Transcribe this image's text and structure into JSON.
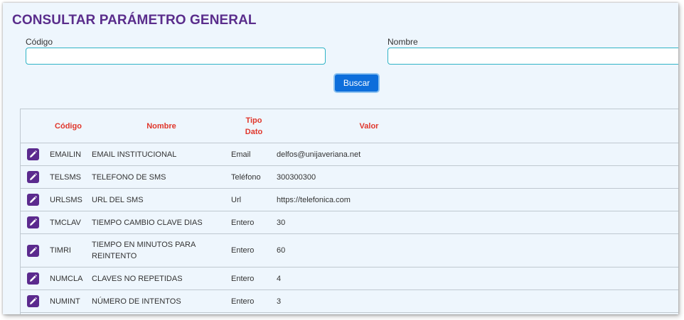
{
  "page": {
    "title": "CONSULTAR PARÁMETRO GENERAL"
  },
  "filters": {
    "codigo": {
      "label": "Código",
      "value": "",
      "placeholder": ""
    },
    "nombre": {
      "label": "Nombre",
      "value": "",
      "placeholder": ""
    }
  },
  "actions": {
    "search_label": "Buscar"
  },
  "table": {
    "headers": {
      "codigo": "Código",
      "nombre": "Nombre",
      "tipo_line1": "Tipo",
      "tipo_line2": "Dato",
      "valor": "Valor"
    },
    "rows": [
      {
        "codigo": "EMAILIN",
        "nombre": "EMAIL INSTITUCIONAL",
        "tipo": "Email",
        "valor": "delfos@unijaveriana.net"
      },
      {
        "codigo": "TELSMS",
        "nombre": "TELEFONO DE SMS",
        "tipo": "Teléfono",
        "valor": "300300300"
      },
      {
        "codigo": "URLSMS",
        "nombre": "URL DEL SMS",
        "tipo": "Url",
        "valor": "https://telefonica.com"
      },
      {
        "codigo": "TMCLAV",
        "nombre": "TIEMPO CAMBIO CLAVE DIAS",
        "tipo": "Entero",
        "valor": "30"
      },
      {
        "codigo": "TIMRI",
        "nombre": "TIEMPO EN MINUTOS PARA REINTENTO",
        "tipo": "Entero",
        "valor": "60"
      },
      {
        "codigo": "NUMCLA",
        "nombre": "CLAVES NO REPETIDAS",
        "tipo": "Entero",
        "valor": "4"
      },
      {
        "codigo": "NUMINT",
        "nombre": "NÚMERO DE INTENTOS",
        "tipo": "Entero",
        "valor": "3"
      }
    ]
  },
  "icons": {
    "edit": "pencil-icon"
  },
  "colors": {
    "title": "#5a2d8c",
    "header_text": "#e0362b",
    "button": "#0d6edb",
    "edit_button": "#5b2a8e",
    "input_border": "#2fb3c6"
  }
}
